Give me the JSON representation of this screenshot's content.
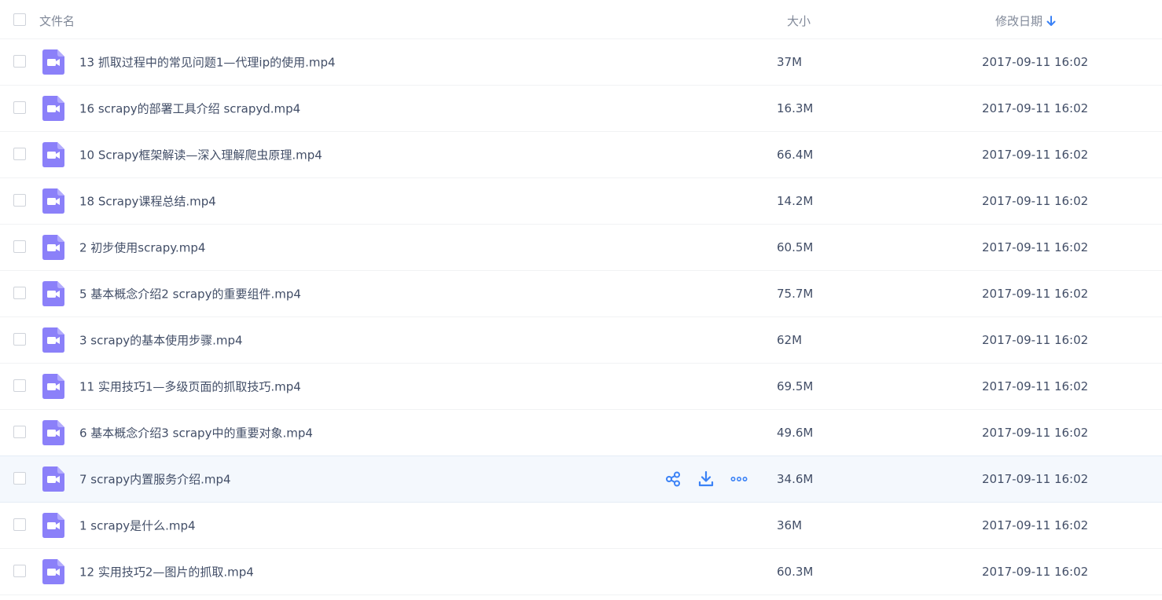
{
  "header": {
    "name_label": "文件名",
    "size_label": "大小",
    "date_label": "修改日期",
    "sort_icon": "arrow-down-icon"
  },
  "colors": {
    "accent": "#3b82f6",
    "video_icon": "#8b80f9",
    "hover_row": "#f4f8fd",
    "text": "#424e67",
    "header_text": "#818999"
  },
  "row_actions": [
    "share-icon",
    "download-icon",
    "more-icon"
  ],
  "files": [
    {
      "name": "13 抓取过程中的常见问题1—代理ip的使用.mp4",
      "size": "37M",
      "date": "2017-09-11 16:02"
    },
    {
      "name": "16 scrapy的部署工具介绍 scrapyd.mp4",
      "size": "16.3M",
      "date": "2017-09-11 16:02"
    },
    {
      "name": "10 Scrapy框架解读—深入理解爬虫原理.mp4",
      "size": "66.4M",
      "date": "2017-09-11 16:02"
    },
    {
      "name": "18 Scrapy课程总结.mp4",
      "size": "14.2M",
      "date": "2017-09-11 16:02"
    },
    {
      "name": "2 初步使用scrapy.mp4",
      "size": "60.5M",
      "date": "2017-09-11 16:02"
    },
    {
      "name": "5 基本概念介绍2 scrapy的重要组件.mp4",
      "size": "75.7M",
      "date": "2017-09-11 16:02"
    },
    {
      "name": "3 scrapy的基本使用步骤.mp4",
      "size": "62M",
      "date": "2017-09-11 16:02"
    },
    {
      "name": "11 实用技巧1—多级页面的抓取技巧.mp4",
      "size": "69.5M",
      "date": "2017-09-11 16:02"
    },
    {
      "name": "6 基本概念介绍3 scrapy中的重要对象.mp4",
      "size": "49.6M",
      "date": "2017-09-11 16:02"
    },
    {
      "name": "7 scrapy内置服务介绍.mp4",
      "size": "34.6M",
      "date": "2017-09-11 16:02"
    },
    {
      "name": "1 scrapy是什么.mp4",
      "size": "36M",
      "date": "2017-09-11 16:02"
    },
    {
      "name": "12 实用技巧2—图片的抓取.mp4",
      "size": "60.3M",
      "date": "2017-09-11 16:02"
    }
  ]
}
